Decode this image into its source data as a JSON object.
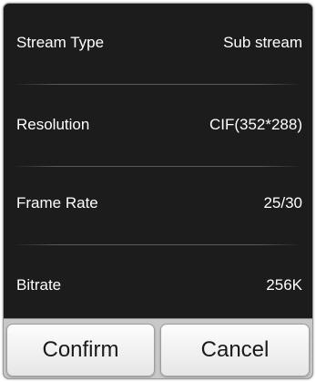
{
  "settings": {
    "rows": [
      {
        "label": "Stream Type",
        "value": "Sub stream"
      },
      {
        "label": "Resolution",
        "value": "CIF(352*288)"
      },
      {
        "label": "Frame Rate",
        "value": "25/30"
      },
      {
        "label": "Bitrate",
        "value": "256K"
      }
    ]
  },
  "buttons": {
    "confirm_label": "Confirm",
    "cancel_label": "Cancel"
  },
  "colors": {
    "dialog_background": "#1c1c1c",
    "text": "#ffffff",
    "button_bar": "#c8c8c8"
  }
}
